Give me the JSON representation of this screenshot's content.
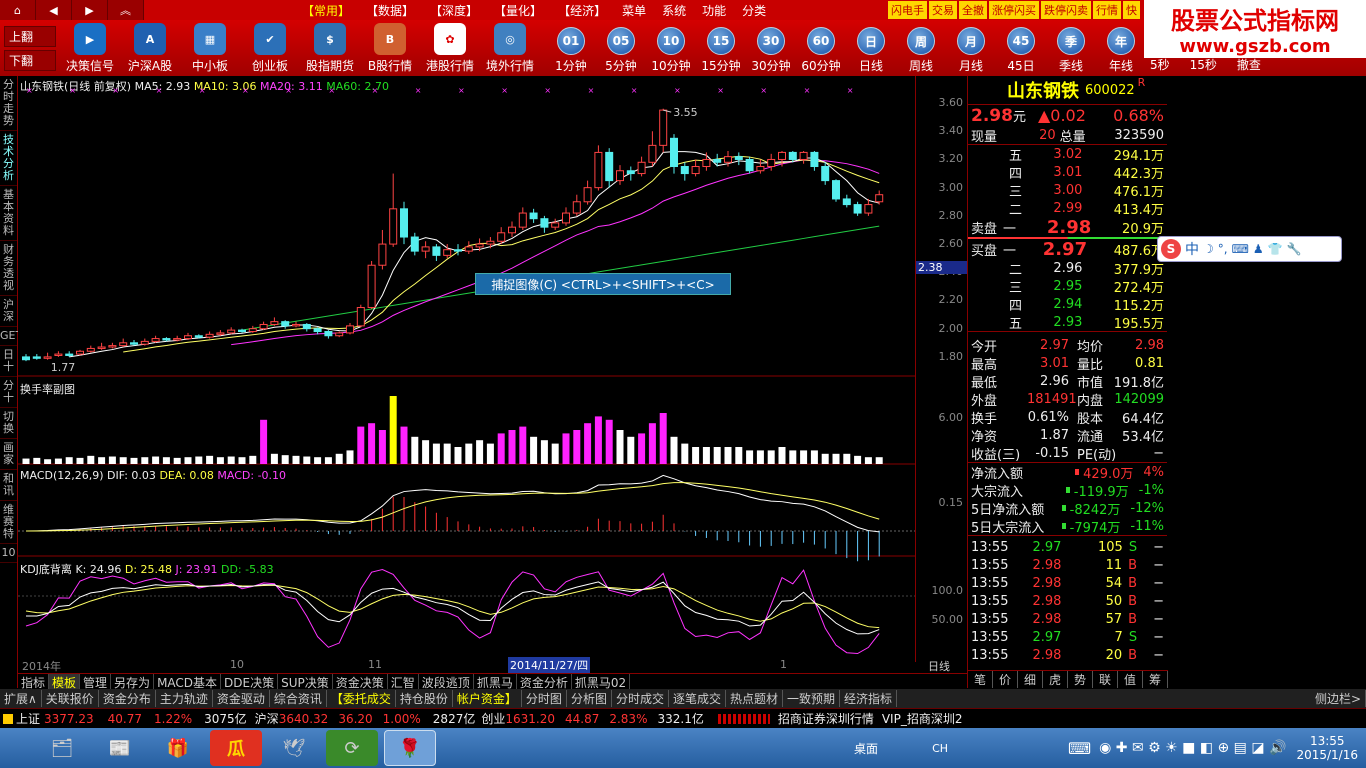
{
  "topmenu": {
    "items": [
      "【常用】",
      "【数据】",
      "【深度】",
      "【量化】",
      "【经济】",
      "菜单",
      "系统",
      "功能",
      "分类"
    ],
    "right": [
      "闪电手",
      "交易",
      "全撤",
      "涨停闪买",
      "跌停闪卖",
      "行情",
      "快"
    ]
  },
  "toolbar": {
    "left": [
      "上翻",
      "下翻"
    ],
    "buttons": [
      {
        "label": "决策信号",
        "bg": "#1a6fc4",
        "ico": "▶"
      },
      {
        "label": "沪深A股",
        "bg": "#2060b0",
        "ico": "A"
      },
      {
        "label": "中小板",
        "bg": "#3a7fc8",
        "ico": "▦"
      },
      {
        "label": "创业板",
        "bg": "#2c70b8",
        "ico": "✔"
      },
      {
        "label": "股指期货",
        "bg": "#3070b0",
        "ico": "$"
      },
      {
        "label": "B股行情",
        "bg": "#d06030",
        "ico": "B"
      },
      {
        "label": "港股行情",
        "bg": "#ffffff",
        "ico": "✿"
      },
      {
        "label": "境外行情",
        "bg": "#4080c0",
        "ico": "◎"
      }
    ],
    "circles": [
      {
        "t": "01",
        "l": "1分钟"
      },
      {
        "t": "05",
        "l": "5分钟"
      },
      {
        "t": "10",
        "l": "10分钟"
      },
      {
        "t": "15",
        "l": "15分钟"
      },
      {
        "t": "30",
        "l": "30分钟"
      },
      {
        "t": "60",
        "l": "60分钟"
      },
      {
        "t": "日",
        "l": "日线"
      },
      {
        "t": "周",
        "l": "周线"
      },
      {
        "t": "月",
        "l": "月线"
      },
      {
        "t": "45",
        "l": "45日"
      },
      {
        "t": "季",
        "l": "季线"
      },
      {
        "t": "年",
        "l": "年线"
      }
    ],
    "extra": [
      "5秒",
      "15秒",
      "撤查"
    ]
  },
  "brand": {
    "t1": "股票公式指标网",
    "t2": "www.gszb.com"
  },
  "sidetabs": [
    "分时走势",
    "技术分析",
    "基本资料",
    "财务透视",
    "沪深",
    "GET",
    "日十",
    "分十",
    "切换",
    "画家",
    "和讯",
    "维赛特",
    "10"
  ],
  "main": {
    "title": "山东钢铁(日线 前复权)",
    "ma5": "MA5: 2.93",
    "ma10": "MA10: 3.06",
    "ma20": "MA20: 3.11",
    "ma60": "MA60: 2.70",
    "high": "3.55",
    "low": "1.77",
    "cursor": "2.38"
  },
  "price_ticks": [
    "3.60",
    "3.40",
    "3.20",
    "3.00",
    "2.80",
    "2.60",
    "2.40",
    "2.20",
    "2.00",
    "1.80"
  ],
  "vol": {
    "title": "换手率副图",
    "tick": "6.00"
  },
  "macd": {
    "title": "MACD(12,26,9)",
    "dif": "DIF: 0.03",
    "dea": "DEA: 0.08",
    "macd": "MACD: -0.10",
    "tick": "0.15"
  },
  "kdj": {
    "title": "KDJ底背离",
    "k": "K: 24.96",
    "d": "D: 25.48",
    "j": "J: 23.91",
    "dd": "DD: -5.83",
    "t1": "100.0",
    "t2": "50.00"
  },
  "xaxis": {
    "labels": [
      "2014年",
      "10",
      "11",
      "1"
    ],
    "date": "2014/11/27/四",
    "period": "日线",
    "plus": "+",
    "minus": "-",
    "zero": "0"
  },
  "popup": "捕捉图像(C)    <CTRL>+<SHIFT>+<C>",
  "stock": {
    "name": "山东钢铁",
    "code": "600022",
    "r": "R",
    "price": "2.98",
    "unit": "元",
    "chg": "▲0.02",
    "pct": "0.68%",
    "now_l": "现量",
    "now": "20",
    "tot_l": "总量",
    "tot": "323590"
  },
  "asks": [
    {
      "l": "五",
      "p": "3.02",
      "v": "294.1万"
    },
    {
      "l": "四",
      "p": "3.01",
      "v": "442.3万"
    },
    {
      "l": "三",
      "p": "3.00",
      "v": "476.1万"
    },
    {
      "l": "二",
      "p": "2.99",
      "v": "413.4万"
    }
  ],
  "sell1": {
    "a": "卖盘",
    "l": "一",
    "p": "2.98",
    "v": "20.9万"
  },
  "buy1": {
    "a": "买盘",
    "l": "一",
    "p": "2.97",
    "v": "487.6万"
  },
  "bids": [
    {
      "l": "二",
      "p": "2.96",
      "v": "377.9万",
      "c": "white"
    },
    {
      "l": "三",
      "p": "2.95",
      "v": "272.4万",
      "c": "green"
    },
    {
      "l": "四",
      "p": "2.94",
      "v": "115.2万",
      "c": "green"
    },
    {
      "l": "五",
      "p": "2.93",
      "v": "195.5万",
      "c": "green"
    }
  ],
  "stats": [
    [
      "今开",
      "2.97",
      "red",
      "均价",
      "2.98",
      "red"
    ],
    [
      "最高",
      "3.01",
      "red",
      "量比",
      "0.81",
      "yellow"
    ],
    [
      "最低",
      "2.96",
      "white",
      "市值",
      "191.8亿",
      "white"
    ],
    [
      "外盘",
      "181491",
      "red",
      "内盘",
      "142099",
      "green"
    ],
    [
      "换手",
      "0.61%",
      "white",
      "股本",
      "64.4亿",
      "white"
    ],
    [
      "净资",
      "1.87",
      "white",
      "流通",
      "53.4亿",
      "white"
    ],
    [
      "收益(三)",
      "-0.15",
      "white",
      "PE(动)",
      "−",
      "white"
    ]
  ],
  "flows": [
    [
      "净流入额",
      "429.0万",
      "4%",
      "red"
    ],
    [
      "大宗流入",
      "-119.9万",
      "-1%",
      "green"
    ],
    [
      "5日净流入额",
      "-8242万",
      "-12%",
      "green"
    ],
    [
      "5日大宗流入",
      "-7974万",
      "-11%",
      "green"
    ]
  ],
  "ticks": [
    [
      "13:55",
      "2.97",
      "105",
      "S",
      "green"
    ],
    [
      "13:55",
      "2.98",
      "11",
      "B",
      "red"
    ],
    [
      "13:55",
      "2.98",
      "54",
      "B",
      "red"
    ],
    [
      "13:55",
      "2.98",
      "50",
      "B",
      "red"
    ],
    [
      "13:55",
      "2.98",
      "57",
      "B",
      "red"
    ],
    [
      "13:55",
      "2.97",
      "7",
      "S",
      "green"
    ],
    [
      "13:55",
      "2.98",
      "20",
      "B",
      "red"
    ]
  ],
  "rtabs": [
    "笔",
    "价",
    "细",
    "虎",
    "势",
    "联",
    "值",
    "筹"
  ],
  "btabs": [
    "指标",
    "模板",
    "管理",
    "另存为",
    "MACD基本",
    "DDE决策",
    "SUP决策",
    "资金决策",
    "汇智",
    "波段逃顶",
    "抓黑马",
    "资金分析",
    "抓黑马02"
  ],
  "funcbar": [
    "扩展∧",
    "关联报价",
    "资金分布",
    "主力轨迹",
    "资金驱动",
    "综合资讯",
    "【委托成交",
    "持仓股份",
    "帐户资金】",
    "分时图",
    "分析图",
    "分时成交",
    "逐笔成交",
    "热点题材",
    "一致预期",
    "经济指标",
    "侧边栏>"
  ],
  "status": {
    "sh_l": "上证",
    "sh": "3377.23",
    "sh_c": "40.77",
    "sh_p": "1.22%",
    "sh_a": "3075亿",
    "hs_l": "沪深",
    "hs": "3640.32",
    "hs_c": "36.20",
    "hs_p": "1.00%",
    "hs_a": "2827亿",
    "cy_l": "创业",
    "cy": "1631.20",
    "cy_c": "44.87",
    "cy_p": "2.83%",
    "cy_a": "332.1亿",
    "broker": "招商证券深圳行情",
    "vip": "VIP_招商深圳2"
  },
  "taskbar": {
    "desk": "桌面",
    "ch": "CH",
    "time": "13:55",
    "date": "2015/1/16"
  },
  "candles": [
    [
      1.8,
      1.78,
      1.82,
      1.77
    ],
    [
      1.8,
      1.79,
      1.82,
      1.78
    ],
    [
      1.79,
      1.8,
      1.83,
      1.78
    ],
    [
      1.81,
      1.82,
      1.84,
      1.8
    ],
    [
      1.82,
      1.81,
      1.84,
      1.8
    ],
    [
      1.82,
      1.84,
      1.85,
      1.81
    ],
    [
      1.84,
      1.86,
      1.88,
      1.83
    ],
    [
      1.86,
      1.87,
      1.9,
      1.85
    ],
    [
      1.87,
      1.88,
      1.9,
      1.86
    ],
    [
      1.88,
      1.9,
      1.93,
      1.87
    ],
    [
      1.9,
      1.89,
      1.92,
      1.88
    ],
    [
      1.89,
      1.91,
      1.93,
      1.88
    ],
    [
      1.91,
      1.93,
      1.95,
      1.9
    ],
    [
      1.93,
      1.92,
      1.94,
      1.91
    ],
    [
      1.92,
      1.93,
      1.95,
      1.91
    ],
    [
      1.93,
      1.95,
      1.97,
      1.92
    ],
    [
      1.95,
      1.94,
      1.96,
      1.93
    ],
    [
      1.94,
      1.96,
      1.98,
      1.93
    ],
    [
      1.96,
      1.97,
      1.99,
      1.95
    ],
    [
      1.97,
      1.99,
      2.01,
      1.96
    ],
    [
      1.99,
      1.98,
      2.0,
      1.97
    ],
    [
      1.98,
      2.0,
      2.02,
      1.97
    ],
    [
      2.0,
      2.03,
      2.05,
      1.99
    ],
    [
      2.03,
      2.05,
      2.08,
      2.02
    ],
    [
      2.05,
      2.02,
      2.06,
      2.0
    ],
    [
      2.02,
      2.03,
      2.05,
      2.01
    ],
    [
      2.03,
      2.0,
      2.04,
      1.98
    ],
    [
      2.0,
      1.98,
      2.01,
      1.96
    ],
    [
      1.98,
      1.95,
      1.99,
      1.93
    ],
    [
      1.95,
      1.97,
      1.98,
      1.94
    ],
    [
      1.97,
      2.02,
      2.04,
      1.96
    ],
    [
      2.02,
      2.15,
      2.17,
      2.01
    ],
    [
      2.15,
      2.45,
      2.48,
      2.14
    ],
    [
      2.45,
      2.6,
      2.7,
      2.42
    ],
    [
      2.6,
      2.85,
      3.1,
      2.58
    ],
    [
      2.85,
      2.65,
      2.9,
      2.6
    ],
    [
      2.65,
      2.55,
      2.68,
      2.52
    ],
    [
      2.55,
      2.58,
      2.62,
      2.5
    ],
    [
      2.58,
      2.52,
      2.6,
      2.48
    ],
    [
      2.52,
      2.56,
      2.6,
      2.5
    ],
    [
      2.56,
      2.55,
      2.6,
      2.52
    ],
    [
      2.55,
      2.58,
      2.62,
      2.53
    ],
    [
      2.58,
      2.6,
      2.64,
      2.55
    ],
    [
      2.6,
      2.62,
      2.65,
      2.57
    ],
    [
      2.62,
      2.68,
      2.72,
      2.6
    ],
    [
      2.68,
      2.72,
      2.76,
      2.65
    ],
    [
      2.72,
      2.82,
      2.86,
      2.7
    ],
    [
      2.82,
      2.78,
      2.85,
      2.75
    ],
    [
      2.78,
      2.72,
      2.8,
      2.68
    ],
    [
      2.72,
      2.75,
      2.78,
      2.7
    ],
    [
      2.75,
      2.82,
      2.86,
      2.73
    ],
    [
      2.82,
      2.9,
      2.95,
      2.8
    ],
    [
      2.9,
      3.0,
      3.05,
      2.88
    ],
    [
      3.0,
      3.25,
      3.3,
      2.98
    ],
    [
      3.25,
      3.05,
      3.28,
      3.0
    ],
    [
      3.05,
      3.12,
      3.16,
      3.02
    ],
    [
      3.12,
      3.1,
      3.15,
      3.05
    ],
    [
      3.1,
      3.18,
      3.22,
      3.08
    ],
    [
      3.18,
      3.3,
      3.4,
      3.15
    ],
    [
      3.3,
      3.55,
      3.56,
      3.25
    ],
    [
      3.35,
      3.15,
      3.38,
      3.1
    ],
    [
      3.15,
      3.1,
      3.18,
      3.05
    ],
    [
      3.1,
      3.15,
      3.2,
      3.08
    ],
    [
      3.15,
      3.2,
      3.25,
      3.12
    ],
    [
      3.2,
      3.18,
      3.24,
      3.15
    ],
    [
      3.18,
      3.22,
      3.26,
      3.15
    ],
    [
      3.22,
      3.2,
      3.25,
      3.16
    ],
    [
      3.2,
      3.12,
      3.22,
      3.1
    ],
    [
      3.12,
      3.15,
      3.2,
      3.1
    ],
    [
      3.15,
      3.2,
      3.24,
      3.12
    ],
    [
      3.2,
      3.25,
      3.26,
      3.15
    ],
    [
      3.25,
      3.2,
      3.26,
      3.18
    ],
    [
      3.2,
      3.25,
      3.26,
      3.17
    ],
    [
      3.25,
      3.15,
      3.26,
      3.12
    ],
    [
      3.15,
      3.05,
      3.18,
      3.02
    ],
    [
      3.05,
      2.92,
      3.06,
      2.9
    ],
    [
      2.92,
      2.88,
      2.95,
      2.86
    ],
    [
      2.88,
      2.82,
      2.9,
      2.8
    ],
    [
      2.82,
      2.88,
      2.92,
      2.8
    ],
    [
      2.9,
      2.95,
      2.98,
      2.88
    ]
  ],
  "volumes": [
    0.8,
    0.9,
    0.7,
    0.8,
    1.0,
    0.9,
    1.2,
    1.0,
    1.1,
    1.0,
    0.9,
    1.0,
    1.1,
    1.0,
    0.9,
    1.0,
    1.1,
    1.2,
    1.0,
    1.1,
    1.0,
    1.2,
    6.5,
    1.5,
    1.3,
    1.2,
    1.1,
    1.0,
    1.0,
    1.5,
    2.0,
    5.5,
    6.0,
    5.0,
    10.0,
    5.5,
    4.0,
    3.5,
    3.0,
    3.0,
    2.5,
    3.0,
    3.5,
    3.0,
    4.5,
    5.0,
    5.5,
    4.0,
    3.5,
    3.0,
    4.5,
    5.0,
    6.0,
    7.0,
    6.5,
    5.0,
    4.0,
    4.5,
    6.0,
    7.5,
    4.0,
    3.0,
    2.5,
    2.5,
    2.5,
    2.5,
    2.5,
    2.0,
    2.0,
    2.0,
    2.5,
    2.0,
    2.0,
    2.0,
    1.5,
    1.5,
    1.5,
    1.2,
    1.0,
    1.0
  ],
  "vol_colors": [
    0,
    0,
    0,
    0,
    0,
    0,
    0,
    0,
    0,
    0,
    0,
    0,
    0,
    0,
    0,
    0,
    0,
    0,
    0,
    0,
    0,
    0,
    1,
    0,
    0,
    0,
    0,
    0,
    0,
    0,
    0,
    1,
    1,
    1,
    2,
    1,
    0,
    0,
    0,
    0,
    0,
    0,
    0,
    0,
    1,
    1,
    1,
    0,
    0,
    0,
    1,
    1,
    1,
    1,
    1,
    0,
    0,
    1,
    1,
    1,
    0,
    0,
    0,
    0,
    0,
    0,
    0,
    0,
    0,
    0,
    0,
    0,
    0,
    0,
    0,
    0,
    0,
    0,
    0,
    0
  ]
}
